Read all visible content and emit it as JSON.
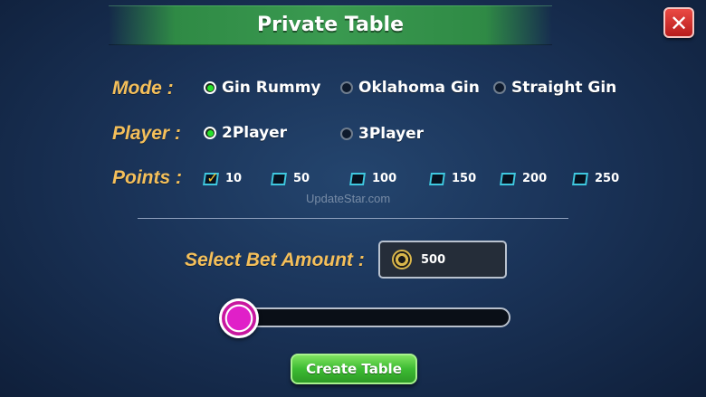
{
  "title": "Private Table",
  "close_icon_glyph": "✕",
  "mode": {
    "label": "Mode :",
    "options": [
      {
        "label": "Gin Rummy",
        "selected": true
      },
      {
        "label": "Oklahoma Gin",
        "selected": false
      },
      {
        "label": "Straight Gin",
        "selected": false
      }
    ]
  },
  "player": {
    "label": "Player :",
    "options": [
      {
        "label": "2Player",
        "selected": true
      },
      {
        "label": "3Player",
        "selected": false
      }
    ]
  },
  "points": {
    "label": "Points :",
    "options": [
      {
        "label": "10",
        "checked": true
      },
      {
        "label": "50",
        "checked": false
      },
      {
        "label": "100",
        "checked": false
      },
      {
        "label": "150",
        "checked": false
      },
      {
        "label": "200",
        "checked": false
      },
      {
        "label": "250",
        "checked": false
      }
    ]
  },
  "watermark": "UpdateStar.com",
  "bet": {
    "label": "Select Bet Amount :",
    "value": "500",
    "slider_level": 0
  },
  "create_button": "Create Table",
  "colors": {
    "accent_label": "#f4bf5a",
    "radio_selected": "#27e02a",
    "checkbox_border": "#3fc8e0",
    "button_green": "#3dbb32",
    "close_red": "#d4302c",
    "slider_chip": "#e020c8"
  }
}
